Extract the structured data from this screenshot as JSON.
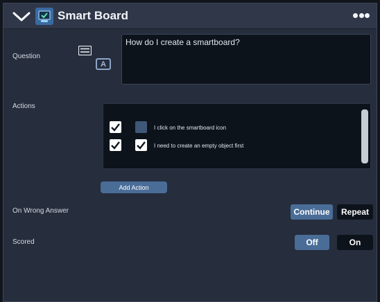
{
  "header": {
    "title": "Smart Board",
    "collapse_icon": "chevron-down-icon",
    "app_icon": "smartboard-icon",
    "menu_icon": "more-dots-icon"
  },
  "question": {
    "label": "Question",
    "value": "How do I create a smartboard?",
    "list_icon": "list-icon",
    "text_format_icon": "A",
    "text_format_icon_name": "text-format-icon"
  },
  "actions": {
    "label": "Actions",
    "items": [
      {
        "text": "I click on the smartboard icon",
        "correct_checked": true,
        "selected_checked": false
      },
      {
        "text": "I need to create an empty object first",
        "correct_checked": true,
        "selected_checked": true
      }
    ],
    "add_label": "Add Action"
  },
  "wrong_answer": {
    "label": "On Wrong Answer",
    "options": [
      "Continue",
      "Repeat"
    ],
    "selected": "Continue"
  },
  "scored": {
    "label": "Scored",
    "options": [
      "Off",
      "On"
    ],
    "selected": "Off"
  },
  "colors": {
    "panel_bg": "#262d3c",
    "header_bg": "#2f3749",
    "field_bg": "#0d131b",
    "accent": "#4a6d98"
  }
}
